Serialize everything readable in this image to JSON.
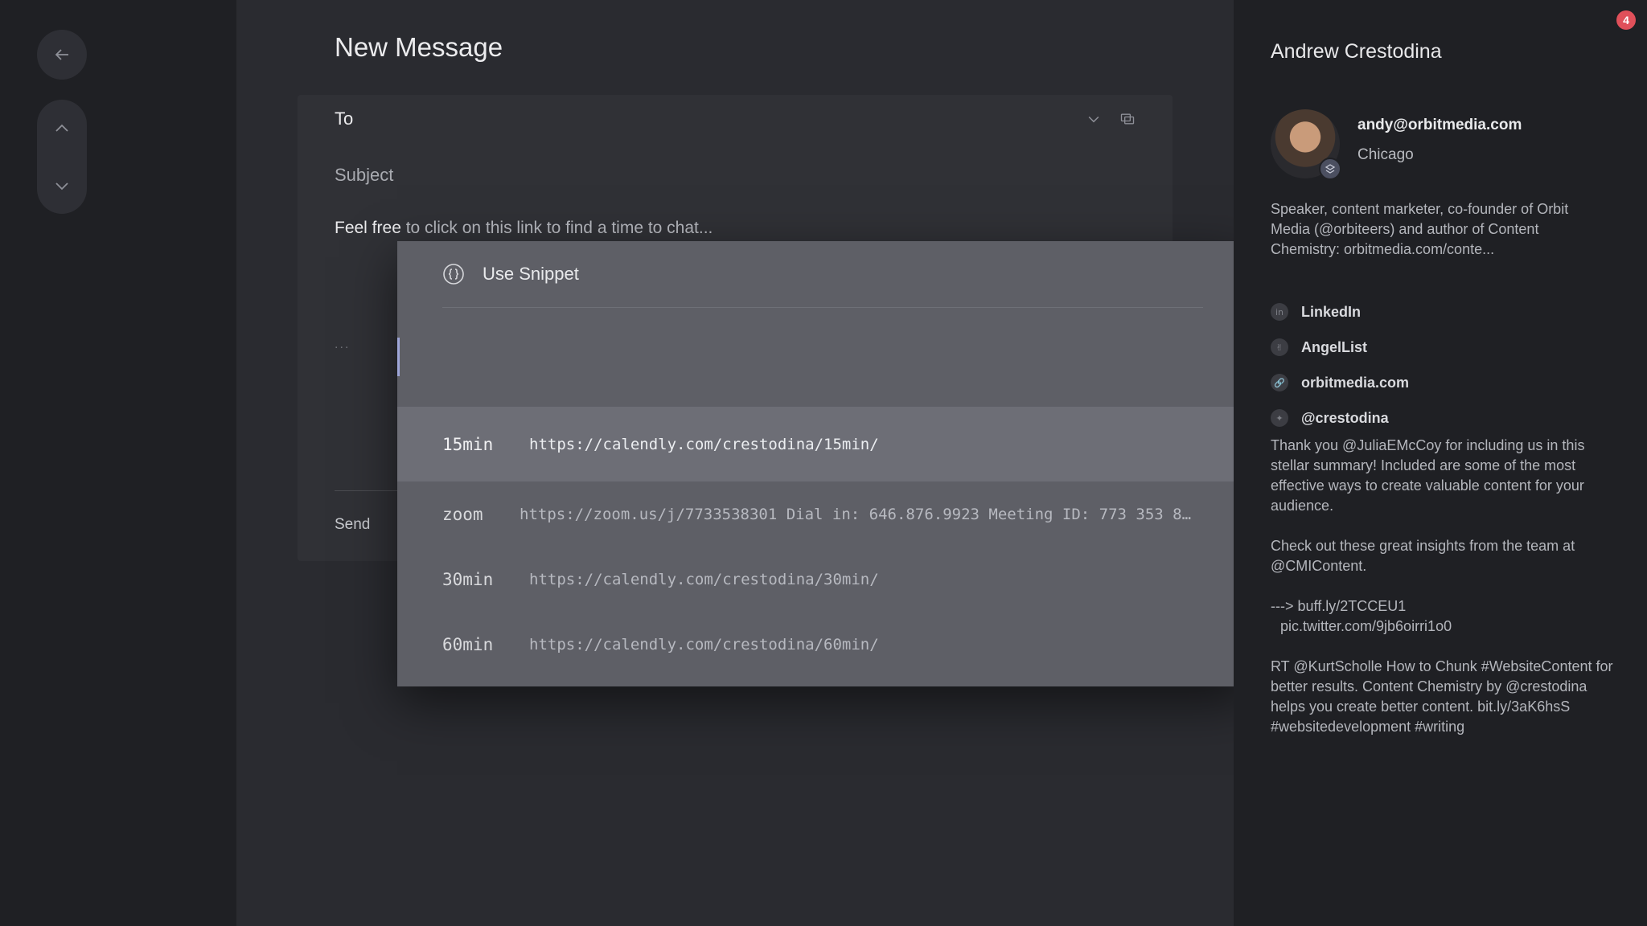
{
  "composer": {
    "title": "New Message",
    "to_label": "To",
    "subject_placeholder": "Subject",
    "body_strong": "Feel free",
    "body_rest": " to click on this link to find a time to chat...",
    "ellipsis": "...",
    "send_label": "Send"
  },
  "snippet_menu": {
    "header": "Use Snippet",
    "items": [
      {
        "key": "15min",
        "value": "https://calendly.com/crestodina/15min/"
      },
      {
        "key": "zoom",
        "value": "https://zoom.us/j/7733538301 Dial in: 646.876.9923 Meeting ID: 773 353 8..."
      },
      {
        "key": "30min",
        "value": "https://calendly.com/crestodina/30min/"
      },
      {
        "key": "60min",
        "value": "https://calendly.com/crestodina/60min/"
      }
    ]
  },
  "contact": {
    "name": "Andrew Crestodina",
    "email": "andy@orbitmedia.com",
    "city": "Chicago",
    "bio": "Speaker, content marketer, co-founder of Orbit Media (@orbiteers) and author of Content Chemistry: orbitmedia.com/conte...",
    "links": [
      {
        "label": "LinkedIn",
        "icon": "linkedin-icon"
      },
      {
        "label": "AngelList",
        "icon": "angellist-icon"
      },
      {
        "label": "orbitmedia.com",
        "icon": "link-icon"
      },
      {
        "label": "@crestodina",
        "icon": "twitter-icon"
      }
    ],
    "tweets": [
      "Thank you @JuliaEMcCoy for including us in this stellar summary! Included are some of the most effective ways to create valuable content for your audience.",
      "Check out these great insights from the team at @CMIContent.",
      "---> buff.ly/2TCCEU1",
      "pic.twitter.com/9jb6oirri1o0",
      "RT @KurtScholle How to Chunk #WebsiteContent for better results. Content Chemistry by @crestodina helps you create better content. bit.ly/3aK6hsS #websitedevelopment #writing"
    ]
  },
  "notification_count": "4"
}
